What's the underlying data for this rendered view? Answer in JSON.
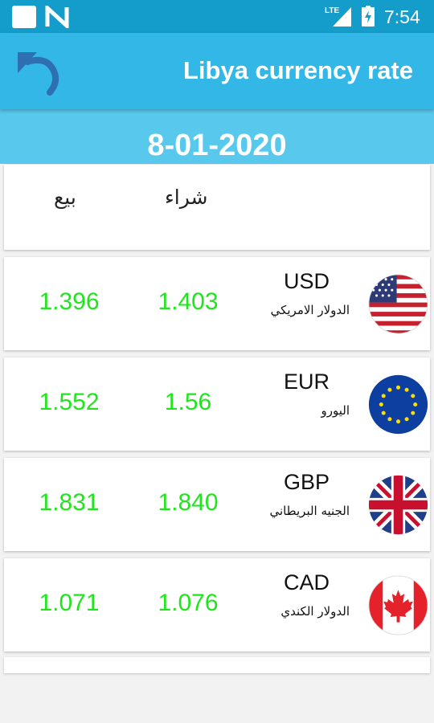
{
  "status_bar": {
    "time": "7:54",
    "network": "LTE"
  },
  "app_bar": {
    "title": "Libya currency rate"
  },
  "date": "8-01-2020",
  "headers": {
    "sell": "بيع",
    "buy": "شراء"
  },
  "rates": [
    {
      "code": "USD",
      "name": "الدولار الامريكي",
      "buy": "1.403",
      "sell": "1.396",
      "flag": "us-flag-icon"
    },
    {
      "code": "EUR",
      "name": "اليورو",
      "buy": "1.56",
      "sell": "1.552",
      "flag": "eu-flag-icon"
    },
    {
      "code": "GBP",
      "name": "الجنيه البريطاني",
      "buy": "1.840",
      "sell": "1.831",
      "flag": "uk-flag-icon"
    },
    {
      "code": "CAD",
      "name": "الدولار الكندي",
      "buy": "1.076",
      "sell": "1.071",
      "flag": "canada-flag-icon"
    }
  ],
  "colors": {
    "status_bar": "#149dcb",
    "app_bar": "#33b7e6",
    "date_band": "#59c8ed",
    "rate_value": "#1fe51c"
  }
}
